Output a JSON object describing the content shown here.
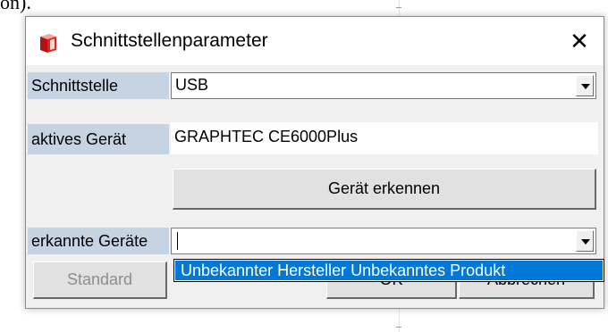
{
  "background": {
    "fragment_text": "on)."
  },
  "dialog": {
    "title": "Schnittstellenparameter",
    "close_glyph": "✕"
  },
  "interface": {
    "label": "Schnittstelle",
    "value": "USB"
  },
  "active_device": {
    "label": "aktives Gerät",
    "value": "GRAPHTEC CE6000Plus"
  },
  "detect_button": {
    "label": "Gerät erkennen"
  },
  "detected_devices": {
    "label": "erkannte Geräte",
    "value": "",
    "options": [
      "Unbekannter Hersteller Unbekanntes Produkt"
    ]
  },
  "footer": {
    "standard_label": "Standard",
    "ok_label": "OK",
    "cancel_label": "Abbrechen"
  },
  "colors": {
    "label_highlight": "#c5d3e2",
    "selection": "#0078d7",
    "dialog_bg": "#f0f0f0",
    "icon_red": "#e0231f"
  },
  "icons": {
    "app": "red-cube-icon",
    "close": "close-icon",
    "dropdown": "chevron-down-icon"
  }
}
